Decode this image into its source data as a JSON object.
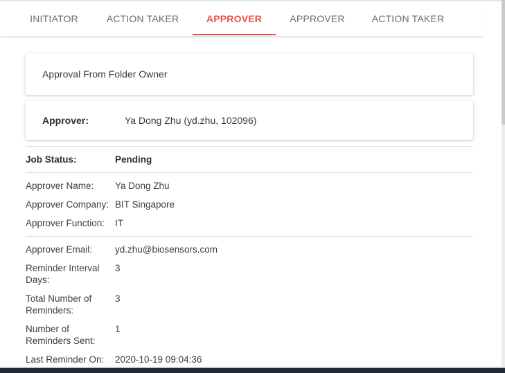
{
  "tabs": [
    {
      "label": "INITIATOR"
    },
    {
      "label": "ACTION TAKER"
    },
    {
      "label": "APPROVER"
    },
    {
      "label": "APPROVER"
    },
    {
      "label": "ACTION TAKER"
    }
  ],
  "active_tab_index": 2,
  "colors": {
    "accent": "#ef4c4c"
  },
  "card_title": "Approval From Folder Owner",
  "approver_card": {
    "label": "Approver:",
    "value": "Ya Dong Zhu (yd.zhu, 102096)"
  },
  "job_status": {
    "label": "Job Status:",
    "value": "Pending"
  },
  "details": {
    "name_label": "Approver Name:",
    "name_value": "Ya Dong Zhu",
    "company_label": "Approver Company:",
    "company_value": "BIT Singapore",
    "function_label": "Approver Function:",
    "function_value": "IT",
    "email_label": "Approver Email:",
    "email_value": "yd.zhu@biosensors.com",
    "interval_label": "Reminder Interval Days:",
    "interval_value": "3",
    "total_label": "Total Number of Reminders:",
    "total_value": "3",
    "sent_label": "Number of Reminders Sent:",
    "sent_value": "1",
    "last_label": "Last Reminder On:",
    "last_value": "2020-10-19 09:04:36"
  }
}
